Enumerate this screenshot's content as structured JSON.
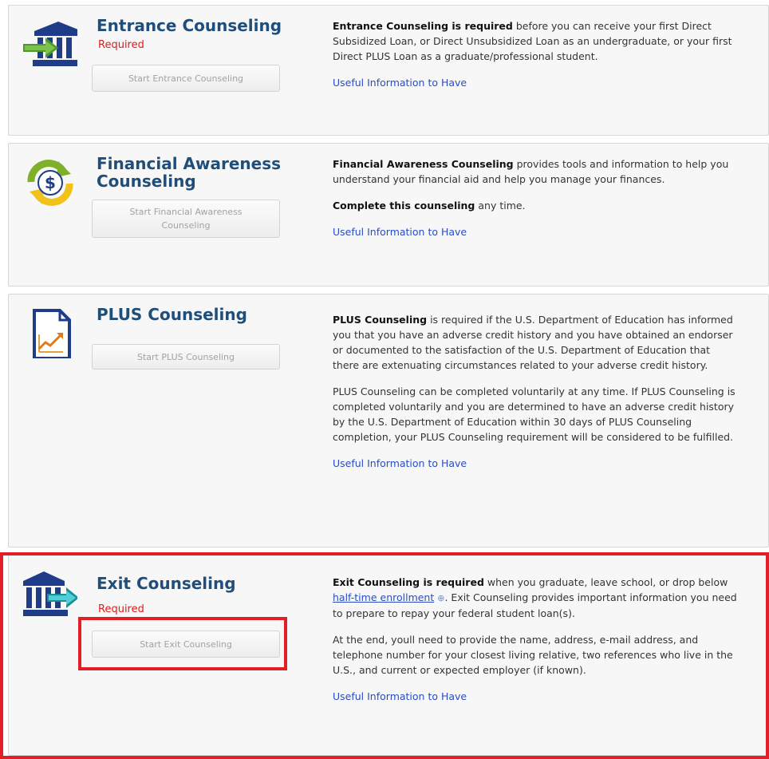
{
  "cards": [
    {
      "title": "Entrance Counseling",
      "required": "Required",
      "button": "Start Entrance Counseling",
      "desc_bold": "Entrance Counseling is required",
      "desc_text": " before you can receive your first Direct Subsidized Loan, or Direct Unsubsidized Loan as an undergraduate, or your first Direct PLUS Loan as a graduate/professional student.",
      "link": "Useful Information to Have"
    },
    {
      "title": "Financial Awareness Counseling",
      "button": "Start Financial Awareness Counseling",
      "desc_bold": "Financial Awareness Counseling",
      "desc_text": " provides tools and information to help you understand your financial aid and help you manage your finances.",
      "desc2_bold": "Complete this counseling",
      "desc2_text": " any time.",
      "link": "Useful Information to Have"
    },
    {
      "title": "PLUS Counseling",
      "button": "Start PLUS Counseling",
      "desc_bold": "PLUS Counseling",
      "desc_text": " is required if the U.S. Department of Education has informed you that you have an adverse credit history and you have obtained an endorser or documented to the satisfaction of the U.S. Department of Education that there are extenuating circumstances related to your adverse credit history.",
      "desc2_text": "PLUS Counseling can be completed voluntarily at any time. If PLUS Counseling is completed voluntarily and you are determined to have an adverse credit history by the U.S. Department of Education within 30 days of PLUS Counseling completion, your PLUS Counseling requirement will be considered to be fulfilled.",
      "link": "Useful Information to Have"
    },
    {
      "title": "Exit Counseling",
      "required": "Required",
      "button": "Start Exit Counseling",
      "desc_bold": "Exit Counseling is required",
      "desc_text_a": " when you graduate, leave school, or drop below ",
      "desc_link": "half-time enrollment",
      "desc_link_icon": "⊕",
      "desc_text_b": ". Exit Counseling provides important information you need to prepare to repay your federal student loan(s).",
      "desc2_text": "At the end, youll need to provide the name, address, e-mail address, and telephone number for your closest living relative, two references who live in the U.S., and current or expected employer (if known).",
      "link": "Useful Information to Have"
    }
  ],
  "icons": {
    "entrance": "bank-arrow-in-icon",
    "financial": "dollar-refresh-icon",
    "plus": "chart-document-icon",
    "exit": "bank-arrow-out-icon"
  },
  "colors": {
    "title": "#1f4e7a",
    "required": "#e21a1a",
    "link": "#2a4dbf",
    "highlight": "#e21f26"
  }
}
